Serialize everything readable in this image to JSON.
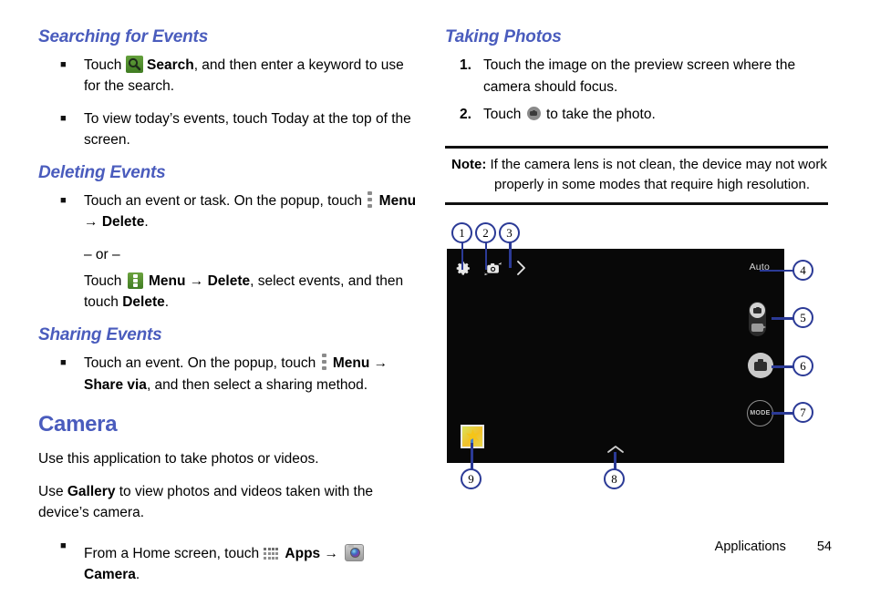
{
  "document": {
    "footer_section": "Applications",
    "footer_page": "54"
  },
  "colors": {
    "heading_blue": "#4a5cbd",
    "callout_blue": "#2b3a96",
    "icon_green": "#4d8f2e",
    "screen_black": "#080808"
  },
  "left_column": {
    "searching": {
      "heading": "Searching for Events",
      "bullets": [
        {
          "pre": "Touch ",
          "icon": "search-icon",
          "bold1": "Search",
          "post": ", and then enter a keyword to use for the search."
        },
        {
          "pre": "To view today’s events, touch Today at the top of the screen.",
          "icon": null,
          "bold1": "",
          "post": ""
        }
      ]
    },
    "deleting": {
      "heading": "Deleting Events",
      "line1_pre": "Touch an event or task. On the popup, touch ",
      "line1_menu": "Menu",
      "line1_arrow": "→",
      "line1_delete": "Delete",
      "line1_end": ".",
      "or_text": "– or –",
      "line2_pre": "Touch ",
      "line2_menu": "Menu",
      "line2_arrow": "→",
      "line2_delete": "Delete",
      "line2_mid": ", select events, and then touch ",
      "line2_delete2": "Delete",
      "line2_end": "."
    },
    "sharing": {
      "heading": "Sharing Events",
      "pre": "Touch an event. On the popup, touch ",
      "menu": "Menu",
      "arrow": "→",
      "share_via": "Share via",
      "post": ", and then select a sharing method."
    },
    "camera": {
      "heading": "Camera",
      "para1": "Use this application to take photos or videos.",
      "para2_pre": "Use ",
      "para2_bold": "Gallery",
      "para2_post": " to view photos and videos taken with the device’s camera.",
      "bullet_pre": "From a Home screen, touch ",
      "bullet_apps": "Apps",
      "bullet_arrow": "→",
      "bullet_camera": "Camera",
      "bullet_end": "."
    }
  },
  "right_column": {
    "taking_photos": {
      "heading": "Taking Photos",
      "steps": [
        {
          "num": "1.",
          "text": "Touch the image on the preview screen where the camera should focus."
        },
        {
          "num": "2.",
          "pre": "Touch ",
          "post": " to take the photo."
        }
      ]
    },
    "note": {
      "label": "Note:",
      "line1": " If the camera lens is not clean, the device may not work",
      "line2": "properly in some modes that require high resolution."
    },
    "camera_diagram": {
      "screen_labels": {
        "auto": "Auto",
        "mode": "MODE"
      },
      "callouts": [
        {
          "id": "1",
          "target": "settings-gear-icon"
        },
        {
          "id": "2",
          "target": "switch-camera-icon"
        },
        {
          "id": "3",
          "target": "expand-chevron-right-icon"
        },
        {
          "id": "4",
          "target": "auto-mode-label"
        },
        {
          "id": "5",
          "target": "camera-video-toggle"
        },
        {
          "id": "6",
          "target": "shutter-button"
        },
        {
          "id": "7",
          "target": "mode-button"
        },
        {
          "id": "8",
          "target": "chevron-up-icon"
        },
        {
          "id": "9",
          "target": "gallery-thumbnail"
        }
      ]
    }
  }
}
